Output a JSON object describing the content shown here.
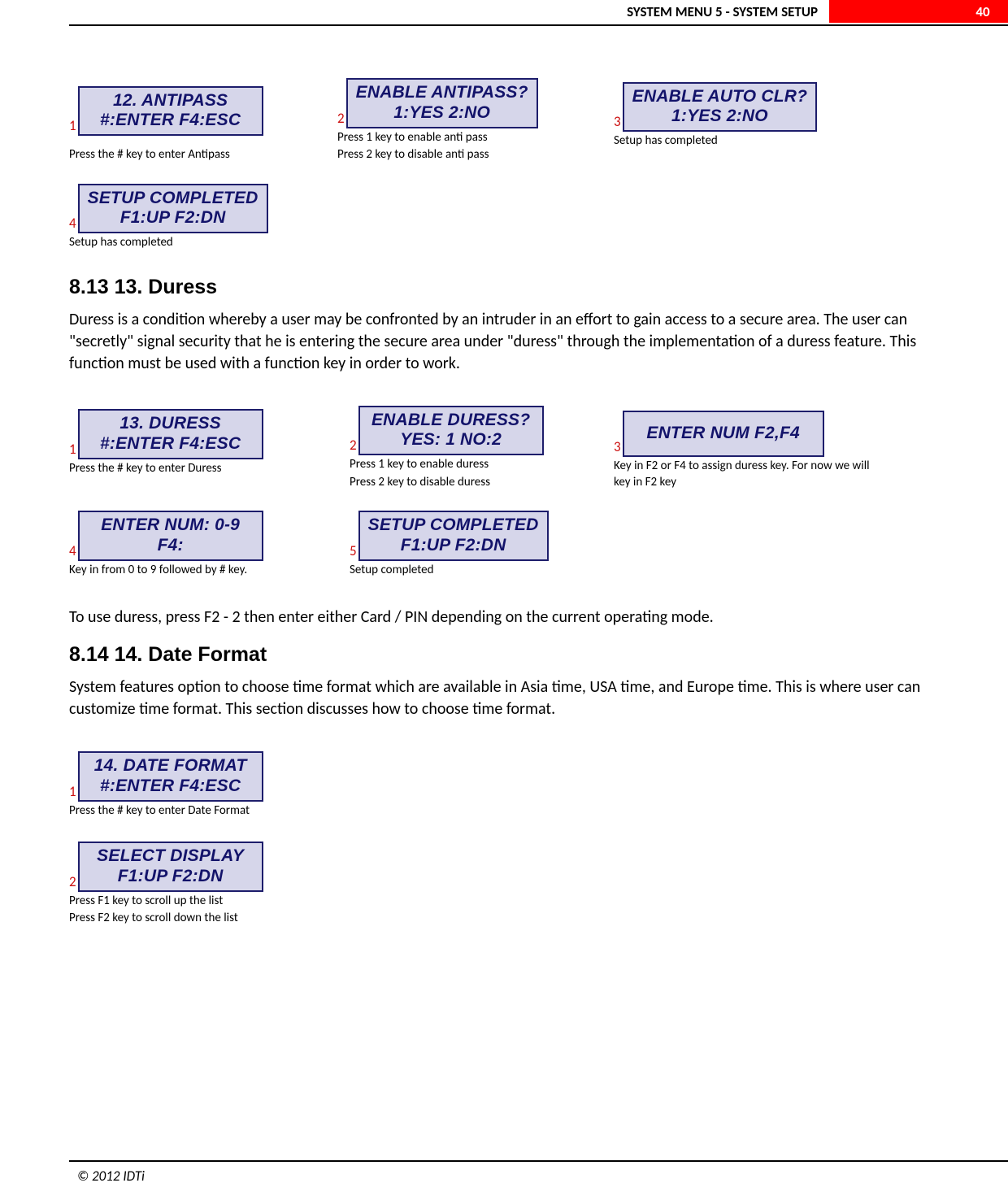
{
  "header": {
    "title": "SYSTEM MENU 5 - SYSTEM SETUP",
    "page_number": "40"
  },
  "antipass": {
    "steps": [
      {
        "num": "1",
        "lcd_line1": "12. ANTIPASS",
        "lcd_line2": "#:ENTER  F4:ESC",
        "caption": "Press the # key to enter Antipass"
      },
      {
        "num": "2",
        "lcd_line1": "ENABLE ANTIPASS?",
        "lcd_line2": "1:YES   2:NO",
        "caption1": "Press 1 key to enable anti pass",
        "caption2": "Press 2 key to disable anti pass"
      },
      {
        "num": "3",
        "lcd_line1": "ENABLE AUTO  CLR?",
        "lcd_line2": "1:YES   2:NO",
        "caption": "Setup has completed"
      },
      {
        "num": "4",
        "lcd_line1": "SETUP COMPLETED",
        "lcd_line2": "F1:UP   F2:DN",
        "caption": "Setup has completed"
      }
    ]
  },
  "sec813": {
    "heading": "8.13    13. Duress",
    "para": "Duress is a condition whereby a user may be confronted by an intruder in an effort to gain access to a secure area. The user can \"secretly\" signal security that he is entering the secure area under \"duress\" through the implementation of a duress feature. This function must be used with a function key in order to work.",
    "steps": [
      {
        "num": "1",
        "lcd_line1": "13. DURESS",
        "lcd_line2": "#:ENTER  F4:ESC",
        "caption": "Press the # key to enter Duress"
      },
      {
        "num": "2",
        "lcd_line1": "ENABLE DURESS?",
        "lcd_line2": "YES: 1   NO:2",
        "caption1": "Press 1 key to enable duress",
        "caption2": "Press 2 key to disable duress"
      },
      {
        "num": "3",
        "lcd_line1": "ENTER NUM F2,F4",
        "lcd_line2": "",
        "caption": "Key in F2 or F4 to assign duress key. For now we will key in F2 key"
      },
      {
        "num": "4",
        "lcd_line1": "ENTER NUM:   0-9",
        "lcd_line2": "F4:",
        "caption": "Key in from 0 to 9 followed by # key."
      },
      {
        "num": "5",
        "lcd_line1": "SETUP COMPLETED",
        "lcd_line2": "F1:UP   F2:DN",
        "caption": "Setup completed"
      }
    ],
    "para2": "To use duress, press F2 - 2 then enter either Card / PIN depending on the current operating mode."
  },
  "sec814": {
    "heading": "8.14    14. Date Format",
    "para": "System features option to choose time format which are available in Asia time, USA time, and Europe time. This is where user can customize time format. This section discusses how to choose time format.",
    "steps": [
      {
        "num": "1",
        "lcd_line1": "14. DATE FORMAT",
        "lcd_line2": "#:ENTER  F4:ESC",
        "caption": "Press the # key to enter Date Format"
      },
      {
        "num": "2",
        "lcd_line1": "SELECT DISPLAY",
        "lcd_line2": "F1:UP   F2:DN",
        "caption1": "Press F1 key to scroll up the list",
        "caption2": "Press F2 key to scroll down the list"
      }
    ]
  },
  "footer": {
    "copyright": "© 2012 IDTi"
  }
}
